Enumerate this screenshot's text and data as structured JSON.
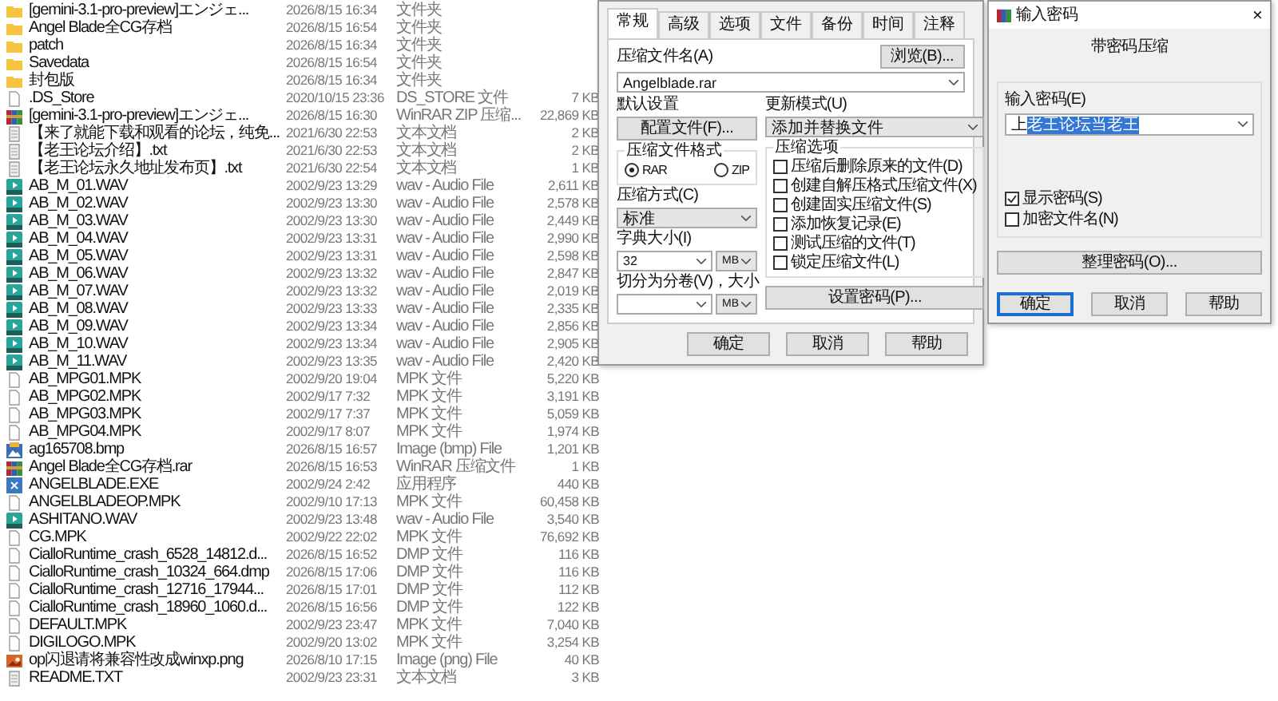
{
  "files": [
    {
      "kind": "folder",
      "name": "[gemini-3.1-pro-preview]エンジェ...",
      "date": "2026/8/15 16:34",
      "type": "文件夹"
    },
    {
      "kind": "folder",
      "name": "Angel Blade全CG存档",
      "date": "2026/8/15 16:54",
      "type": "文件夹"
    },
    {
      "kind": "folder",
      "name": "patch",
      "date": "2026/8/15 16:34",
      "type": "文件夹"
    },
    {
      "kind": "folder",
      "name": "Savedata",
      "date": "2026/8/15 16:54",
      "type": "文件夹"
    },
    {
      "kind": "folder",
      "name": "封包版",
      "date": "2026/8/15 16:34",
      "type": "文件夹"
    },
    {
      "kind": "file",
      "name": ".DS_Store",
      "date": "2020/10/15 23:36",
      "type": "DS_STORE 文件",
      "size": "7 KB"
    },
    {
      "kind": "archive",
      "name": "[gemini-3.1-pro-preview]エンジェ...",
      "date": "2026/8/15 16:30",
      "type": "WinRAR ZIP 压缩...",
      "size": "22,869 KB"
    },
    {
      "kind": "text",
      "name": "【来了就能下载和观看的论坛，纯免...",
      "date": "2021/6/30 22:53",
      "type": "文本文档",
      "size": "2 KB"
    },
    {
      "kind": "text",
      "name": "【老王论坛介绍】.txt",
      "date": "2021/6/30 22:53",
      "type": "文本文档",
      "size": "2 KB"
    },
    {
      "kind": "text",
      "name": "【老王论坛永久地址发布页】.txt",
      "date": "2021/6/30 22:54",
      "type": "文本文档",
      "size": "1 KB"
    },
    {
      "kind": "audio",
      "name": "AB_M_01.WAV",
      "date": "2002/9/23 13:29",
      "type": "wav - Audio File",
      "size": "2,611 KB"
    },
    {
      "kind": "audio",
      "name": "AB_M_02.WAV",
      "date": "2002/9/23 13:30",
      "type": "wav - Audio File",
      "size": "2,578 KB"
    },
    {
      "kind": "audio",
      "name": "AB_M_03.WAV",
      "date": "2002/9/23 13:30",
      "type": "wav - Audio File",
      "size": "2,449 KB"
    },
    {
      "kind": "audio",
      "name": "AB_M_04.WAV",
      "date": "2002/9/23 13:31",
      "type": "wav - Audio File",
      "size": "2,990 KB"
    },
    {
      "kind": "audio",
      "name": "AB_M_05.WAV",
      "date": "2002/9/23 13:31",
      "type": "wav - Audio File",
      "size": "2,598 KB"
    },
    {
      "kind": "audio",
      "name": "AB_M_06.WAV",
      "date": "2002/9/23 13:32",
      "type": "wav - Audio File",
      "size": "2,847 KB"
    },
    {
      "kind": "audio",
      "name": "AB_M_07.WAV",
      "date": "2002/9/23 13:32",
      "type": "wav - Audio File",
      "size": "2,019 KB"
    },
    {
      "kind": "audio",
      "name": "AB_M_08.WAV",
      "date": "2002/9/23 13:33",
      "type": "wav - Audio File",
      "size": "2,335 KB"
    },
    {
      "kind": "audio",
      "name": "AB_M_09.WAV",
      "date": "2002/9/23 13:34",
      "type": "wav - Audio File",
      "size": "2,856 KB"
    },
    {
      "kind": "audio",
      "name": "AB_M_10.WAV",
      "date": "2002/9/23 13:34",
      "type": "wav - Audio File",
      "size": "2,905 KB"
    },
    {
      "kind": "audio",
      "name": "AB_M_11.WAV",
      "date": "2002/9/23 13:35",
      "type": "wav - Audio File",
      "size": "2,420 KB"
    },
    {
      "kind": "file",
      "name": "AB_MPG01.MPK",
      "date": "2002/9/20 19:04",
      "type": "MPK 文件",
      "size": "5,220 KB"
    },
    {
      "kind": "file",
      "name": "AB_MPG02.MPK",
      "date": "2002/9/17 7:32",
      "type": "MPK 文件",
      "size": "3,191 KB"
    },
    {
      "kind": "file",
      "name": "AB_MPG03.MPK",
      "date": "2002/9/17 7:37",
      "type": "MPK 文件",
      "size": "5,059 KB"
    },
    {
      "kind": "file",
      "name": "AB_MPG04.MPK",
      "date": "2002/9/17 8:07",
      "type": "MPK 文件",
      "size": "1,974 KB"
    },
    {
      "kind": "image",
      "name": "ag165708.bmp",
      "date": "2026/8/15 16:57",
      "type": "Image (bmp) File",
      "size": "1,201 KB"
    },
    {
      "kind": "archive",
      "name": "Angel Blade全CG存档.rar",
      "date": "2026/8/15 16:53",
      "type": "WinRAR 压缩文件",
      "size": "1 KB"
    },
    {
      "kind": "program",
      "name": "ANGELBLADE.EXE",
      "date": "2002/9/24 2:42",
      "type": "应用程序",
      "size": "440 KB"
    },
    {
      "kind": "file",
      "name": "ANGELBLADEOP.MPK",
      "date": "2002/9/10 17:13",
      "type": "MPK 文件",
      "size": "60,458 KB"
    },
    {
      "kind": "audio",
      "name": "ASHITANO.WAV",
      "date": "2002/9/23 13:48",
      "type": "wav - Audio File",
      "size": "3,540 KB"
    },
    {
      "kind": "file",
      "name": "CG.MPK",
      "date": "2002/9/22 22:02",
      "type": "MPK 文件",
      "size": "76,692 KB"
    },
    {
      "kind": "file",
      "name": "CialloRuntime_crash_6528_14812.d...",
      "date": "2026/8/15 16:52",
      "type": "DMP 文件",
      "size": "116 KB"
    },
    {
      "kind": "file",
      "name": "CialloRuntime_crash_10324_664.dmp",
      "date": "2026/8/15 17:06",
      "type": "DMP 文件",
      "size": "116 KB"
    },
    {
      "kind": "file",
      "name": "CialloRuntime_crash_12716_17944...",
      "date": "2026/8/15 17:01",
      "type": "DMP 文件",
      "size": "112 KB"
    },
    {
      "kind": "file",
      "name": "CialloRuntime_crash_18960_1060.d...",
      "date": "2026/8/15 16:56",
      "type": "DMP 文件",
      "size": "122 KB"
    },
    {
      "kind": "file",
      "name": "DEFAULT.MPK",
      "date": "2002/9/23 23:47",
      "type": "MPK 文件",
      "size": "7,040 KB"
    },
    {
      "kind": "file",
      "name": "DIGILOGO.MPK",
      "date": "2002/9/20 13:02",
      "type": "MPK 文件",
      "size": "3,254 KB"
    },
    {
      "kind": "photo",
      "name": "op闪退请将兼容性改成winxp.png",
      "date": "2026/8/10 17:15",
      "type": "Image (png) File",
      "size": "40 KB"
    },
    {
      "kind": "text",
      "name": "README.TXT",
      "date": "2002/9/23 23:31",
      "type": "文本文档",
      "size": "3 KB"
    }
  ],
  "archive_dialog": {
    "tabs": [
      {
        "label": "常规",
        "selected": true
      },
      {
        "label": "高级",
        "selected": false
      },
      {
        "label": "选项",
        "selected": false
      },
      {
        "label": "文件",
        "selected": false
      },
      {
        "label": "备份",
        "selected": false
      },
      {
        "label": "时间",
        "selected": false
      },
      {
        "label": "注释",
        "selected": false
      }
    ],
    "archive_name_label": "压缩文件名(A)",
    "browse_button": "浏览(B)...",
    "archive_name": "Angelblade.rar",
    "default_settings_label": "默认设置",
    "profiles_button": "配置文件(F)...",
    "update_mode_label": "更新模式(U)",
    "update_mode": "添加并替换文件",
    "format_group": "压缩文件格式",
    "formats": [
      {
        "label": "RAR",
        "selected": true
      },
      {
        "label": "ZIP",
        "selected": false
      }
    ],
    "method_label": "压缩方式(C)",
    "method": "标准",
    "dictionary_label": "字典大小(I)",
    "dictionary": "32",
    "dictionary_unit": "MB",
    "split_label": "切分为分卷(V)，大小",
    "split_unit": "MB",
    "options_group": "压缩选项",
    "options": [
      {
        "label": "压缩后删除原来的文件(D)",
        "checked": false
      },
      {
        "label": "创建自解压格式压缩文件(X)",
        "checked": false
      },
      {
        "label": "创建固实压缩文件(S)",
        "checked": false
      },
      {
        "label": "添加恢复记录(E)",
        "checked": false
      },
      {
        "label": "测试压缩的文件(T)",
        "checked": false
      },
      {
        "label": "锁定压缩文件(L)",
        "checked": false
      }
    ],
    "password_button": "设置密码(P)...",
    "buttons": [
      "确定",
      "取消",
      "帮助"
    ]
  },
  "password_dialog": {
    "title": "输入密码",
    "close": "×",
    "heading": "带密码压缩",
    "field_label": "输入密码(E)",
    "value_unselected": "上",
    "value_selected": "老王论坛当老王",
    "checkboxes": [
      {
        "label": "显示密码(S)",
        "checked": true
      },
      {
        "label": "加密文件名(N)",
        "checked": false
      }
    ],
    "organize_button": "整理密码(O)...",
    "buttons": [
      {
        "label": "确定",
        "selected": true
      },
      {
        "label": "取消",
        "selected": false
      },
      {
        "label": "帮助",
        "selected": false
      }
    ]
  }
}
